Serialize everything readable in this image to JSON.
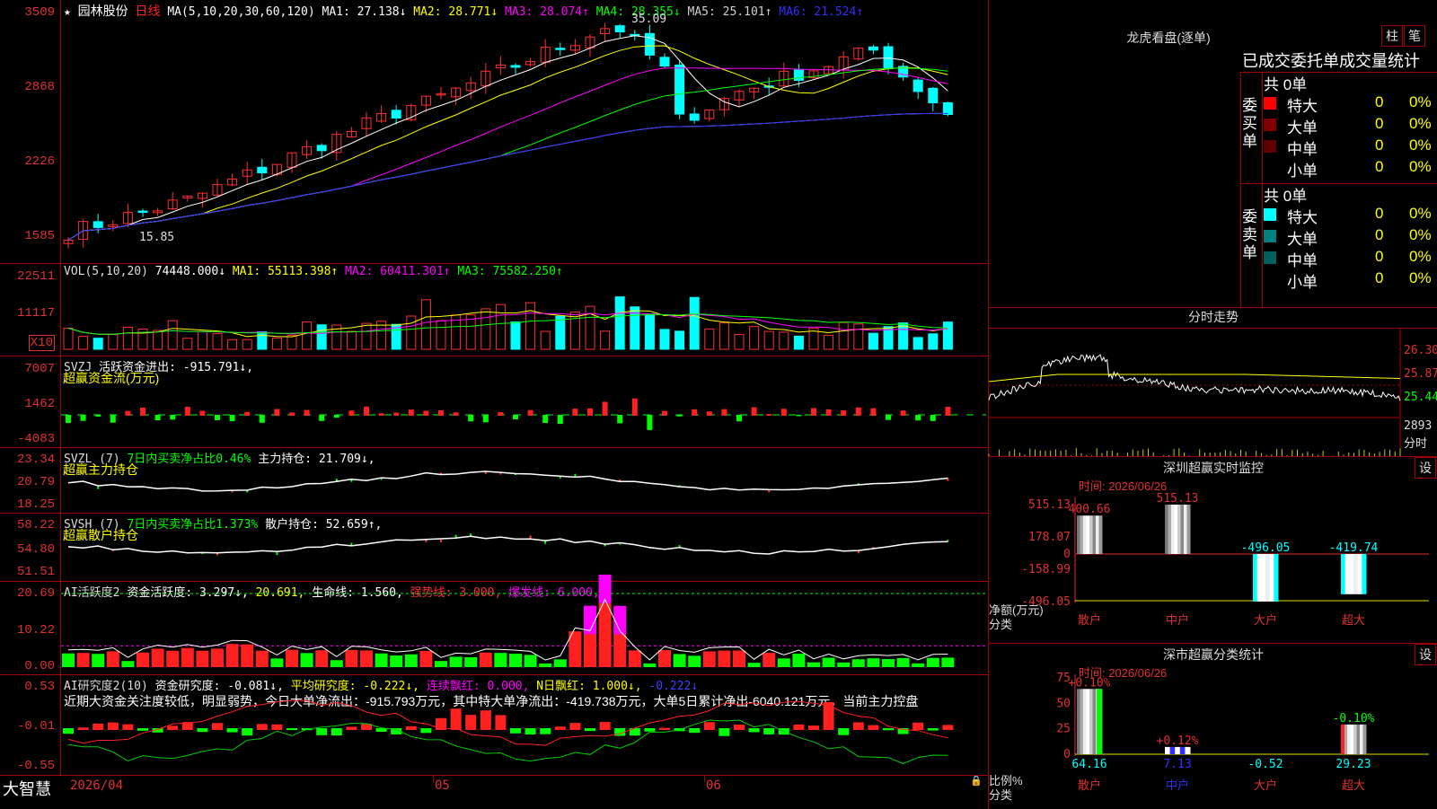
{
  "stock": {
    "name": "园林股份",
    "period": "日线"
  },
  "main": {
    "ma_label": "MA(5,10,20,30,60,120)",
    "ma": [
      {
        "label": "MA1: 27.138↓",
        "color": "#ffffff"
      },
      {
        "label": "MA2: 28.771↓",
        "color": "#ffff00"
      },
      {
        "label": "MA3: 28.074↑",
        "color": "#ff00ff"
      },
      {
        "label": "MA4: 28.355↓",
        "color": "#00ff00"
      },
      {
        "label": "MA5: 25.101↑",
        "color": "#d0d0d0"
      },
      {
        "label": "MA6: 21.524↑",
        "color": "#3030ff"
      }
    ],
    "ticks": [
      "3509",
      "2868",
      "2226",
      "1585"
    ],
    "high_label": "35.09",
    "low_label": "15.85"
  },
  "vol": {
    "title": "VOL(5,10,20)",
    "value": "74448.000↓",
    "ma": [
      {
        "label": "MA1: 55113.398↑",
        "color": "#ffff00"
      },
      {
        "label": "MA2: 60411.301↑",
        "color": "#ff00ff"
      },
      {
        "label": "MA3: 75582.250↑",
        "color": "#00ff00"
      }
    ],
    "ticks": [
      "22511",
      "11117"
    ],
    "unit": "X10"
  },
  "svzj": {
    "title": "SVZJ",
    "desc": "活跃资金进出: -915.791↓,",
    "sub": "超赢资金流(万元)",
    "ticks": [
      "7007",
      "1462",
      "-4083"
    ]
  },
  "svzl": {
    "title": "SVZL (7)",
    "desc": "7日内买卖净占比0.46%",
    "hold": "主力持仓: 21.709↓,",
    "sub": "超赢主力持仓",
    "ticks": [
      "23.34",
      "20.79",
      "18.25"
    ]
  },
  "svsh": {
    "title": "SVSH (7)",
    "desc": "7日内买卖净占比1.373%",
    "hold": "散户持仓: 52.659↑,",
    "sub": "超赢散户持仓",
    "ticks": [
      "58.22",
      "54.80",
      "51.51"
    ]
  },
  "ai1": {
    "title": "AI活跃度2",
    "a": "资金活跃度: 3.297↓,",
    "b": "20.691,",
    "c": "生命线: 1.560,",
    "d": "强势线: 3.000,",
    "e": "爆发线: 6.000,",
    "ticks": [
      "20.69",
      "10.22",
      "0.00"
    ]
  },
  "ai2": {
    "title": "AI研究度2(10)",
    "a": "资金研究度: -0.081↓,",
    "b": "平均研究度: -0.222↓,",
    "c": "连续飘红: 0.000,",
    "d": "N日飘红: 1.000↓,",
    "e": "-0.222↓",
    "comment": "近期大资金关注度较低，明显弱势，今日大单净流出：-915.793万元，其中特大单净流出：-419.738万元，大单5日累计净出-6040.121万元，当前主力控盘",
    "ticks": [
      "0.53",
      "-0.01",
      "-0.55"
    ]
  },
  "dates": {
    "start": "2026/04",
    "d1": "05",
    "d2": "06"
  },
  "brand": "大智慧",
  "lhb": {
    "title": "龙虎看盘(逐单)",
    "btn1": "柱",
    "btn2": "笔",
    "sub": "已成交委托单成交量统计",
    "buy": {
      "label": "委买单",
      "total": "共 0单",
      "rows": [
        {
          "name": "特大",
          "v": "0",
          "p": "0%",
          "color": "#ff0000"
        },
        {
          "name": "大单",
          "v": "0",
          "p": "0%",
          "color": "#800000"
        },
        {
          "name": "中单",
          "v": "0",
          "p": "0%",
          "color": "#600000"
        },
        {
          "name": "小单",
          "v": "0",
          "p": "0%",
          "color": "#000000"
        }
      ]
    },
    "sell": {
      "label": "委卖单",
      "total": "共 0单",
      "rows": [
        {
          "name": "特大",
          "v": "0",
          "p": "0%",
          "color": "#00ffff"
        },
        {
          "name": "大单",
          "v": "0",
          "p": "0%",
          "color": "#008080"
        },
        {
          "name": "中单",
          "v": "0",
          "p": "0%",
          "color": "#006060"
        },
        {
          "name": "小单",
          "v": "0",
          "p": "0%",
          "color": "#000000"
        }
      ]
    }
  },
  "intraday": {
    "title": "分时走势",
    "ticks": [
      "26.30",
      "25.87",
      "25.44"
    ],
    "vol": "2893",
    "vol_label": "分时"
  },
  "monitor": {
    "title": "深圳超赢实时监控",
    "btn": "设",
    "time": "时间: 2026/06/26",
    "ticks": [
      "515.13",
      "178.07",
      "0",
      "-158.99",
      "-496.05"
    ],
    "ylabel": "净额(万元)",
    "xlabel": "分类",
    "bars": [
      {
        "cat": "散户",
        "v": 400.66,
        "label": "400.66"
      },
      {
        "cat": "中户",
        "v": 515.13,
        "label": "515.13"
      },
      {
        "cat": "大户",
        "v": -496.05,
        "label": "-496.05"
      },
      {
        "cat": "超大",
        "v": -419.74,
        "label": "-419.74"
      }
    ]
  },
  "classify": {
    "title": "深市超赢分类统计",
    "btn": "设",
    "time": "时间: 2026/06/26",
    "ticks": [
      "75",
      "50",
      "25",
      "0"
    ],
    "ylabel": "比例%",
    "xlabel": "分类",
    "bars": [
      {
        "cat": "散户",
        "v": 64.16,
        "label": "64.16",
        "top": "+0.10%"
      },
      {
        "cat": "中户",
        "v": 7.13,
        "label": "7.13",
        "top": "+0.12%"
      },
      {
        "cat": "大户",
        "v": -0.52,
        "label": "-0.52",
        "top": ""
      },
      {
        "cat": "超大",
        "v": 29.23,
        "label": "29.23",
        "top": "-0.10%"
      }
    ]
  }
}
